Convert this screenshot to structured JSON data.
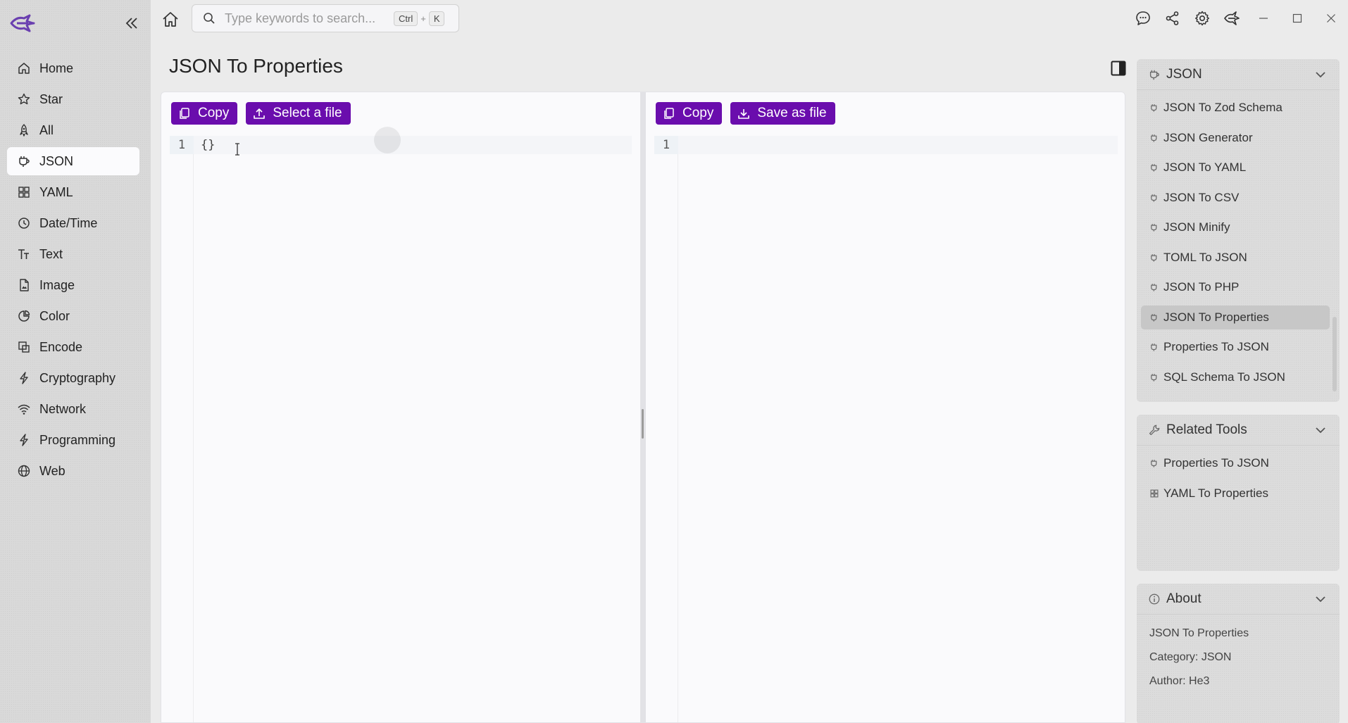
{
  "sidebar": {
    "items": [
      {
        "label": "Home",
        "icon": "home-icon"
      },
      {
        "label": "Star",
        "icon": "star-icon"
      },
      {
        "label": "All",
        "icon": "rocket-icon"
      },
      {
        "label": "JSON",
        "icon": "json-icon",
        "active": true
      },
      {
        "label": "YAML",
        "icon": "grid-icon"
      },
      {
        "label": "Date/Time",
        "icon": "clock-icon"
      },
      {
        "label": "Text",
        "icon": "text-icon"
      },
      {
        "label": "Image",
        "icon": "image-icon"
      },
      {
        "label": "Color",
        "icon": "palette-icon"
      },
      {
        "label": "Encode",
        "icon": "encode-icon"
      },
      {
        "label": "Cryptography",
        "icon": "bolt-icon"
      },
      {
        "label": "Network",
        "icon": "wifi-icon"
      },
      {
        "label": "Programming",
        "icon": "bolt-icon"
      },
      {
        "label": "Web",
        "icon": "globe-icon"
      }
    ]
  },
  "search": {
    "placeholder": "Type keywords to search...",
    "value": "",
    "shortcut_mod": "Ctrl",
    "shortcut_plus": "+",
    "shortcut_key": "K"
  },
  "main": {
    "title": "JSON To Properties",
    "left_pane": {
      "copy_label": "Copy",
      "select_file_label": "Select a file",
      "line_number": "1",
      "content": "{}"
    },
    "right_pane": {
      "copy_label": "Copy",
      "save_file_label": "Save as file",
      "line_number": "1",
      "content": ""
    }
  },
  "right_panel": {
    "json_card": {
      "title": "JSON",
      "items": [
        "JSON To Zod Schema",
        "JSON Generator",
        "JSON To YAML",
        "JSON To CSV",
        "JSON Minify",
        "TOML To JSON",
        "JSON To PHP",
        "JSON To Properties",
        "Properties To JSON",
        "SQL Schema To JSON"
      ],
      "active_index": 7
    },
    "related_card": {
      "title": "Related Tools",
      "items": [
        "Properties To JSON",
        "YAML To Properties"
      ]
    },
    "about_card": {
      "title": "About",
      "name": "JSON To Properties",
      "category": "Category: JSON",
      "author": "Author: He3"
    }
  },
  "colors": {
    "accent": "#6a0dad",
    "sidebar_bg": "#d9d9d9",
    "content_bg": "#fafafc"
  }
}
